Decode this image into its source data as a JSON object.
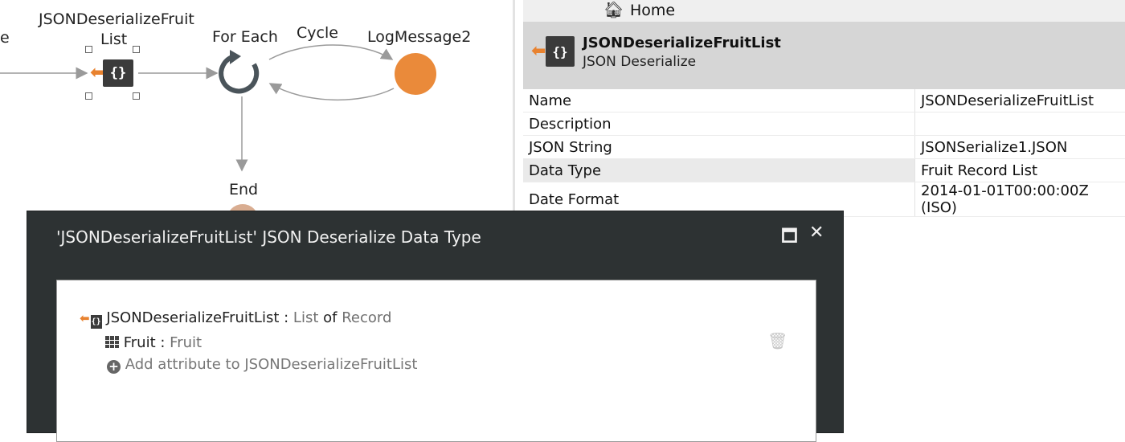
{
  "flow": {
    "left_cut_label": "e",
    "json_node_label_line1": "JSONDeserializeFruit",
    "json_node_label_line2": "List",
    "json_node_glyph": "{}",
    "foreach_label": "For Each",
    "cycle_label": "Cycle",
    "log_label": "LogMessage2",
    "end_label": "End",
    "icons": {
      "deserialize": "json-deserialize-icon",
      "foreach": "foreach-cycle-icon",
      "log": "log-message-node",
      "end": "end-node"
    }
  },
  "properties": {
    "home_label": "Home",
    "header_title": "JSONDeserializeFruitList",
    "header_subtitle": "JSON Deserialize",
    "rows": [
      {
        "key": "Name",
        "value": "JSONDeserializeFruitList"
      },
      {
        "key": "Description",
        "value": ""
      },
      {
        "key": "JSON String",
        "value": "JSONSerialize1.JSON"
      },
      {
        "key": "Data Type",
        "value": "Fruit Record List"
      },
      {
        "key": "Date Format",
        "value": "2014-01-01T00:00:00Z (ISO)"
      }
    ]
  },
  "dialog": {
    "title": "'JSONDeserializeFruitList' JSON Deserialize Data Type",
    "maximize_glyph": "🗖",
    "close_glyph": "✕",
    "root_name": "JSONDeserializeFruitList",
    "root_sep": " : ",
    "root_list": "List",
    "root_of": " of ",
    "root_record": "Record",
    "attr_name": "Fruit",
    "attr_sep": " : ",
    "attr_type": "Fruit",
    "add_attribute": "Add attribute to JSONDeserializeFruitList"
  },
  "colors": {
    "accent_orange": "#e8822f",
    "dialog_bg": "#2d3233",
    "node_dark": "#3b3b3b",
    "log_node": "#ea8a3a"
  }
}
